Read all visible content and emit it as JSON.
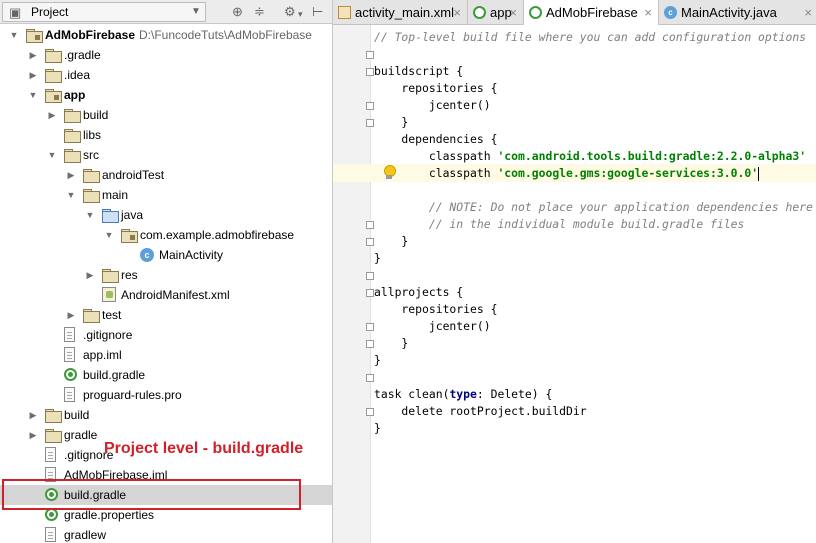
{
  "project_panel": {
    "view_label": "Project",
    "tree": [
      {
        "label": "AdMobFirebase",
        "suffix": "D:\\FuncodeTuts\\AdMobFirebase",
        "depth": 0,
        "icon": "module-folder",
        "expanded": true,
        "bold": true
      },
      {
        "label": ".gradle",
        "depth": 1,
        "icon": "folder",
        "expanded": false
      },
      {
        "label": ".idea",
        "depth": 1,
        "icon": "folder",
        "expanded": false
      },
      {
        "label": "app",
        "depth": 1,
        "icon": "module-folder",
        "expanded": true,
        "bold": true
      },
      {
        "label": "build",
        "depth": 2,
        "icon": "folder",
        "expanded": false
      },
      {
        "label": "libs",
        "depth": 2,
        "icon": "folder",
        "expanded": null
      },
      {
        "label": "src",
        "depth": 2,
        "icon": "folder",
        "expanded": true
      },
      {
        "label": "androidTest",
        "depth": 3,
        "icon": "folder",
        "expanded": false
      },
      {
        "label": "main",
        "depth": 3,
        "icon": "folder",
        "expanded": true
      },
      {
        "label": "java",
        "depth": 4,
        "icon": "source-folder",
        "expanded": true
      },
      {
        "label": "com.example.admobfirebase",
        "depth": 5,
        "icon": "package",
        "expanded": true
      },
      {
        "label": "MainActivity",
        "depth": 6,
        "icon": "class",
        "expanded": null
      },
      {
        "label": "res",
        "depth": 4,
        "icon": "res-folder",
        "expanded": false
      },
      {
        "label": "AndroidManifest.xml",
        "depth": 4,
        "icon": "manifest",
        "expanded": null
      },
      {
        "label": "test",
        "depth": 3,
        "icon": "folder",
        "expanded": false
      },
      {
        "label": ".gitignore",
        "depth": 2,
        "icon": "file",
        "expanded": null
      },
      {
        "label": "app.iml",
        "depth": 2,
        "icon": "file",
        "expanded": null
      },
      {
        "label": "build.gradle",
        "depth": 2,
        "icon": "gradle",
        "expanded": null
      },
      {
        "label": "proguard-rules.pro",
        "depth": 2,
        "icon": "file",
        "expanded": null
      },
      {
        "label": "build",
        "depth": 1,
        "icon": "folder",
        "expanded": false
      },
      {
        "label": "gradle",
        "depth": 1,
        "icon": "folder",
        "expanded": false
      },
      {
        "label": ".gitignore",
        "depth": 1,
        "icon": "file",
        "expanded": null
      },
      {
        "label": "AdMobFirebase.iml",
        "depth": 1,
        "icon": "file",
        "expanded": null
      },
      {
        "label": "build.gradle",
        "depth": 1,
        "icon": "gradle",
        "expanded": null,
        "selected": true
      },
      {
        "label": "gradle.properties",
        "depth": 1,
        "icon": "gradle",
        "expanded": null
      },
      {
        "label": "gradlew",
        "depth": 1,
        "icon": "file",
        "expanded": null
      }
    ]
  },
  "annotation": {
    "text": "Project level - build.gradle",
    "color": "#d0212a"
  },
  "tabs": [
    {
      "label": "activity_main.xml",
      "icon": "xml-icon"
    },
    {
      "label": "app",
      "icon": "gradle-icon"
    },
    {
      "label": "AdMobFirebase",
      "icon": "gradle-icon",
      "active": true
    },
    {
      "label": "MainActivity.java",
      "icon": "class-icon"
    }
  ],
  "editor": {
    "caret_line": 9,
    "lines": [
      [
        {
          "t": "// Top-level build file where you can add configuration options",
          "c": "cm"
        }
      ],
      [],
      [
        {
          "t": "buildscript {"
        }
      ],
      [
        {
          "t": "    repositories {"
        }
      ],
      [
        {
          "t": "        jcenter()"
        }
      ],
      [
        {
          "t": "    }"
        }
      ],
      [
        {
          "t": "    dependencies {"
        }
      ],
      [
        {
          "t": "        classpath "
        },
        {
          "t": "'com.android.tools.build:gradle:2.2.0-alpha3'",
          "c": "str"
        }
      ],
      [
        {
          "t": "        classpath "
        },
        {
          "t": "'com.google.gms:google-services:3.0.0'",
          "c": "str"
        }
      ],
      [],
      [
        {
          "t": "        // NOTE: Do not place your application dependencies here",
          "c": "cm"
        }
      ],
      [
        {
          "t": "        // in the individual module build.gradle files",
          "c": "cm"
        }
      ],
      [
        {
          "t": "    }"
        }
      ],
      [
        {
          "t": "}"
        }
      ],
      [],
      [
        {
          "t": "allprojects {"
        }
      ],
      [
        {
          "t": "    repositories {"
        }
      ],
      [
        {
          "t": "        jcenter()"
        }
      ],
      [
        {
          "t": "    }"
        }
      ],
      [
        {
          "t": "}"
        }
      ],
      [],
      [
        {
          "t": "task "
        },
        {
          "t": "clean("
        },
        {
          "t": "type",
          "c": "kw"
        },
        {
          "t": ": Delete) {"
        }
      ],
      [
        {
          "t": "    delete rootProject.buildDir"
        }
      ],
      [
        {
          "t": "}"
        }
      ]
    ]
  },
  "colors": {
    "comment": "#808080",
    "string": "#008000",
    "keyword": "#000080",
    "annotation_red": "#d0212a",
    "selection": "#d5d5d5"
  }
}
